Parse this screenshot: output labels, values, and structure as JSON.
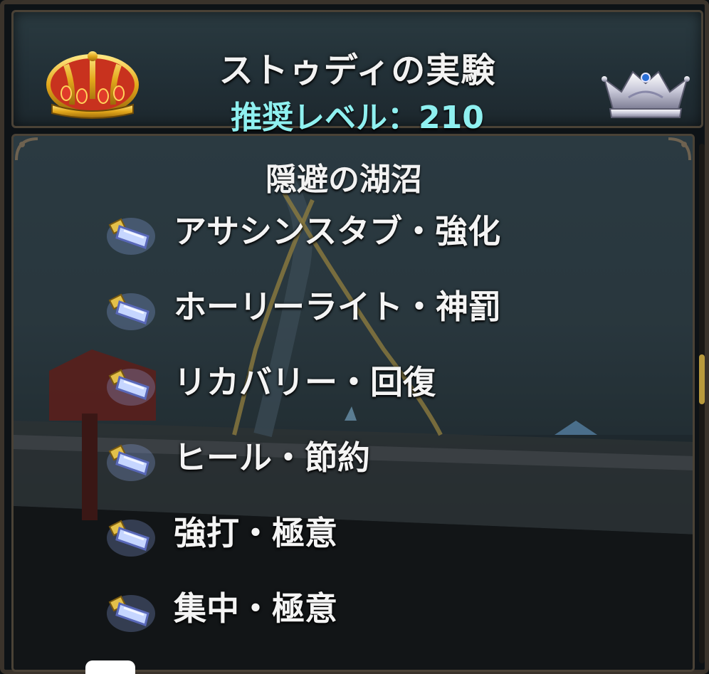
{
  "header": {
    "title": "ストゥディの実験",
    "recommended_level": "推奨レベル：210"
  },
  "section": {
    "title": "隠避の湖沼"
  },
  "skills": [
    {
      "label": "アサシンスタブ・強化",
      "icon": "crystal-scroll-icon"
    },
    {
      "label": "ホーリーライト・神罰",
      "icon": "crystal-scroll-icon"
    },
    {
      "label": "リカバリー・回復",
      "icon": "crystal-scroll-icon"
    },
    {
      "label": "ヒール・節約",
      "icon": "crystal-scroll-icon"
    },
    {
      "label": "強打・極意",
      "icon": "crystal-scroll-icon"
    },
    {
      "label": "集中・極意",
      "icon": "crystal-scroll-icon"
    }
  ],
  "colors": {
    "title_text": "#f2f2f2",
    "level_text": "#8ff0f0",
    "frame": "#4a4236",
    "scroll_thumb": "#b89a3c"
  },
  "icons": {
    "left_crown": "gold-crown-icon",
    "right_crown": "silver-crown-icon"
  }
}
